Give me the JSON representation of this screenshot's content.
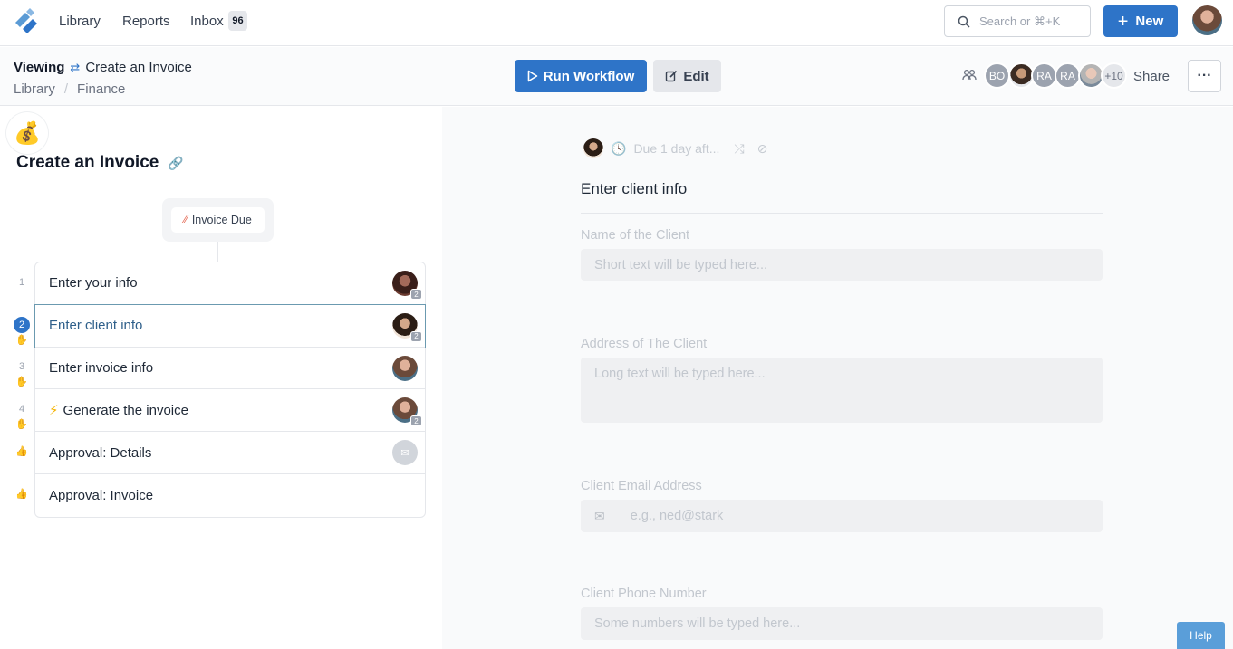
{
  "nav": {
    "links": [
      "Library",
      "Reports",
      "Inbox"
    ],
    "inbox_count": "96",
    "search_placeholder": "Search or ⌘+K",
    "new_label": "New"
  },
  "subheader": {
    "viewing_label": "Viewing",
    "workflow_name": "Create an Invoice",
    "breadcrumb": [
      "Library",
      "Finance"
    ],
    "run_label": "Run Workflow",
    "edit_label": "Edit",
    "avatars": [
      "BO",
      "RA",
      "RA"
    ],
    "more_count": "+10",
    "share_label": "Share",
    "more_label": "···"
  },
  "workflow": {
    "emoji": "💰",
    "title": "Create an Invoice",
    "trigger": "Invoice Due",
    "tasks": [
      {
        "num": "1",
        "label": "Enter your info",
        "count": "2"
      },
      {
        "num": "2",
        "label": "Enter client info",
        "count": "2"
      },
      {
        "num": "3",
        "label": "Enter invoice info",
        "count": ""
      },
      {
        "num": "4",
        "label": "Generate the invoice",
        "count": "2"
      },
      {
        "num": "",
        "label": "Approval: Details",
        "count": ""
      },
      {
        "num": "",
        "label": "Approval: Invoice",
        "count": ""
      }
    ]
  },
  "step": {
    "due": "Due 1 day aft...",
    "title": "Enter client info",
    "fields": [
      {
        "label": "Name of the Client",
        "placeholder": "Short text will be typed here..."
      },
      {
        "label": "Address of The Client",
        "placeholder": "Long text will be typed here..."
      },
      {
        "label": "Client Email Address",
        "placeholder": "e.g., ned@stark"
      },
      {
        "label": "Client Phone Number",
        "placeholder": "Some numbers will be typed here..."
      }
    ]
  },
  "help_label": "Help",
  "colors": {
    "accent": "#2e74c8",
    "active_border": "#6b9ab0",
    "help": "#5a9ed9"
  }
}
